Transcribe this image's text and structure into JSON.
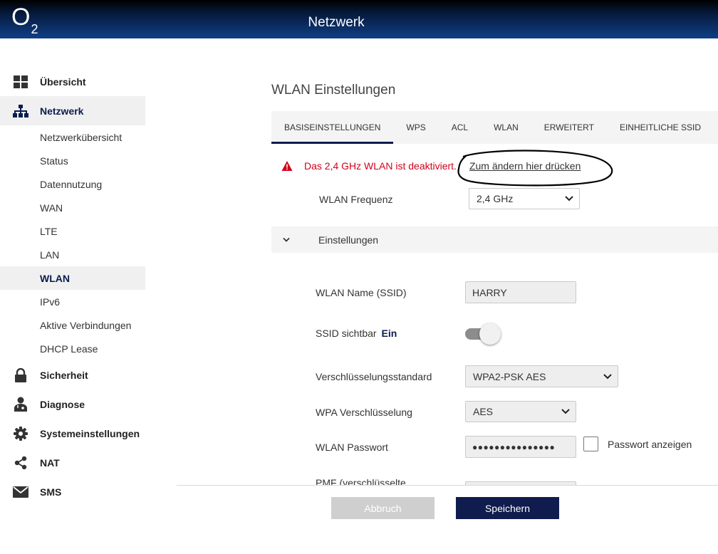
{
  "header": {
    "logo": "O",
    "logo_sub": "2",
    "title": "Netzwerk"
  },
  "sidebar": {
    "items": [
      {
        "label": "Übersicht",
        "icon": "dashboard-icon"
      },
      {
        "label": "Netzwerk",
        "icon": "network-icon",
        "active": true
      },
      {
        "label": "Sicherheit",
        "icon": "lock-icon"
      },
      {
        "label": "Diagnose",
        "icon": "doctor-icon"
      },
      {
        "label": "Systemeinstellungen",
        "icon": "gear-icon"
      },
      {
        "label": "NAT",
        "icon": "share-icon"
      },
      {
        "label": "SMS",
        "icon": "mail-icon"
      }
    ],
    "subitems": [
      "Netzwerkübersicht",
      "Status",
      "Datennutzung",
      "WAN",
      "LTE",
      "LAN",
      "WLAN",
      "IPv6",
      "Aktive Verbindungen",
      "DHCP Lease"
    ],
    "active_subitem": "WLAN"
  },
  "main": {
    "title": "WLAN Einstellungen",
    "tabs": [
      "BASISEINSTELLUNGEN",
      "WPS",
      "ACL",
      "WLAN",
      "ERWEITERT",
      "EINHEITLICHE SSID"
    ],
    "active_tab": "BASISEINSTELLUNGEN",
    "alert": {
      "text": "Das 2,4 GHz WLAN ist deaktiviert.",
      "link": "Zum ändern hier drücken"
    },
    "frequency": {
      "label": "WLAN Frequenz",
      "value": "2,4 GHz"
    },
    "section": {
      "label": "Einstellungen"
    },
    "ssid": {
      "label": "WLAN Name (SSID)",
      "value": "HARRY"
    },
    "ssid_visible": {
      "label": "SSID sichtbar",
      "state": "Ein"
    },
    "encryption_standard": {
      "label": "Verschlüsselungsstandard",
      "value": "WPA2-PSK AES"
    },
    "wpa_encryption": {
      "label": "WPA Verschlüsselung",
      "value": "AES"
    },
    "password": {
      "label": "WLAN Passwort",
      "value": "●●●●●●●●●●●●●●●",
      "show_label": "Passwort anzeigen"
    },
    "pmf": {
      "label": "PMF (verschlüsselte"
    }
  },
  "footer": {
    "cancel_label": "Abbruch",
    "save_label": "Speichern"
  },
  "colors": {
    "accent": "#0f1c4d",
    "alert": "#d0021b"
  }
}
